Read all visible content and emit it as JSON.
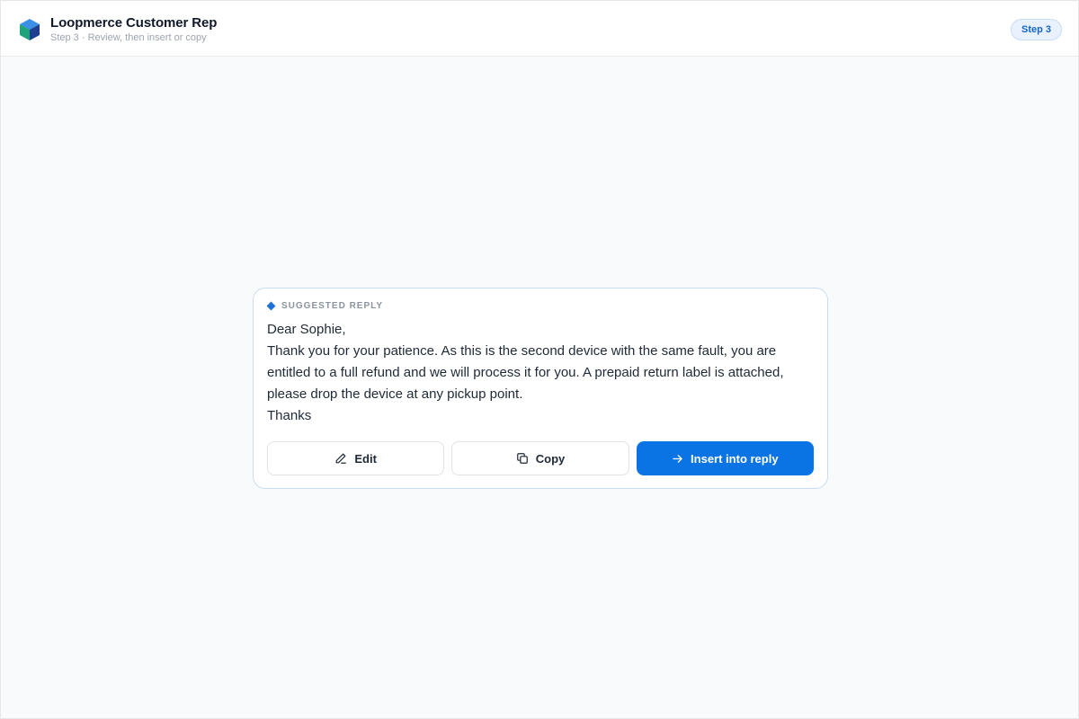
{
  "header": {
    "app_title": "Loopmerce Customer Rep",
    "subtitle": "Step 3 · Review, then insert or copy",
    "step_badge": "Step 3",
    "logo_icon": "cube-icon"
  },
  "card": {
    "label": "SUGGESTED REPLY",
    "reply_lines": [
      "Dear Sophie,",
      "Thank you for your patience. As this is the second device with the same fault, you are entitled to a full refund and we will process it for you. A prepaid return label is attached, please drop the device at any pickup point.",
      "Thanks"
    ],
    "actions": {
      "edit_label": "Edit",
      "edit_icon": "pencil-icon",
      "copy_label": "Copy",
      "copy_icon": "copy-icon",
      "insert_label": "Insert into reply",
      "insert_icon": "arrow-right-icon"
    }
  },
  "colors": {
    "accent": "#0b74e5",
    "badge_text": "#1566c8",
    "badge_bg": "#e8f1fd"
  }
}
